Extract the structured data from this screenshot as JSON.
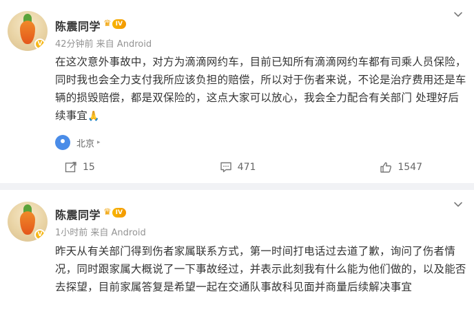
{
  "posts": [
    {
      "author": "陈震同学",
      "level_tag": "IV",
      "meta": "42分钟前  来自 Android",
      "text": "在这次意外事故中，对方为滴滴网约车，目前已知所有滴滴网约车都有司乘人员保险，同时我也会全力支付我所应该负担的赔偿，所以对于伤者来说，不论是治疗费用还是车辆的损毁赔偿，都是双保险的，这点大家可以放心，我会全力配合有关部门 处理好后续事宜",
      "emoji": "🙏",
      "location": "北京",
      "reposts": "15",
      "comments": "471",
      "likes": "1547"
    },
    {
      "author": "陈震同学",
      "level_tag": "IV",
      "meta": "1小时前  来自 Android",
      "text": "昨天从有关部门得到伤者家属联系方式，第一时间打电话过去道了歉，询问了伤者情况，同时跟家属大概说了一下事故经过，并表示此刻我有什么能为他们做的，以及能否去探望，目前家属答复是希望一起在交通队事故科见面并商量后续解决事宜"
    }
  ],
  "icons": {
    "verified_badge": "V",
    "more_menu": "chevron-down-icon",
    "location": "location-pin-icon",
    "repost": "repost-icon",
    "comment": "comment-icon",
    "like": "thumbs-up-icon"
  },
  "colors": {
    "accent_location": "#4a8ce8",
    "level_badge": "#f3a300",
    "meta_text": "#939393"
  }
}
